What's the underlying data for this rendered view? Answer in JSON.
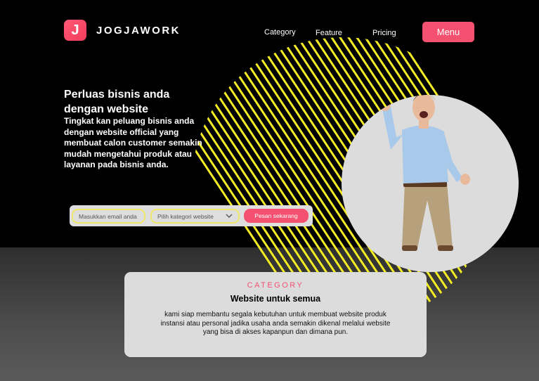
{
  "brand": {
    "logo_letter": "J",
    "name": "JOGJAWORK",
    "accent": "#f4506f"
  },
  "nav": [
    {
      "label": "Category"
    },
    {
      "label": "Feature"
    },
    {
      "label": "Pricing"
    }
  ],
  "menu_label": "Menu",
  "hero": {
    "title": "Perluas bisnis  anda dengan website",
    "description": "Tingkat kan  peluang bisnis anda dengan website official yang membuat calon customer semakin mudah mengetahui produk atau layanan pada bisnis anda."
  },
  "form": {
    "email_placeholder": "Masukkan email anda",
    "category_selected": "Pilih kategori website",
    "submit_label": "Pesan sekarang"
  },
  "category_card": {
    "kicker": "CATEGORY",
    "title": "Website untuk semua",
    "description": "kami siap membantu segala kebutuhan untuk membuat website produk instansi atau personal jadika usaha anda semakin dikenal melalui website yang bisa di akses kapanpun dan dimana pun."
  },
  "colors": {
    "hatch": "#f3ec23",
    "card_bg": "#dcdcdc",
    "background": "#000000"
  }
}
